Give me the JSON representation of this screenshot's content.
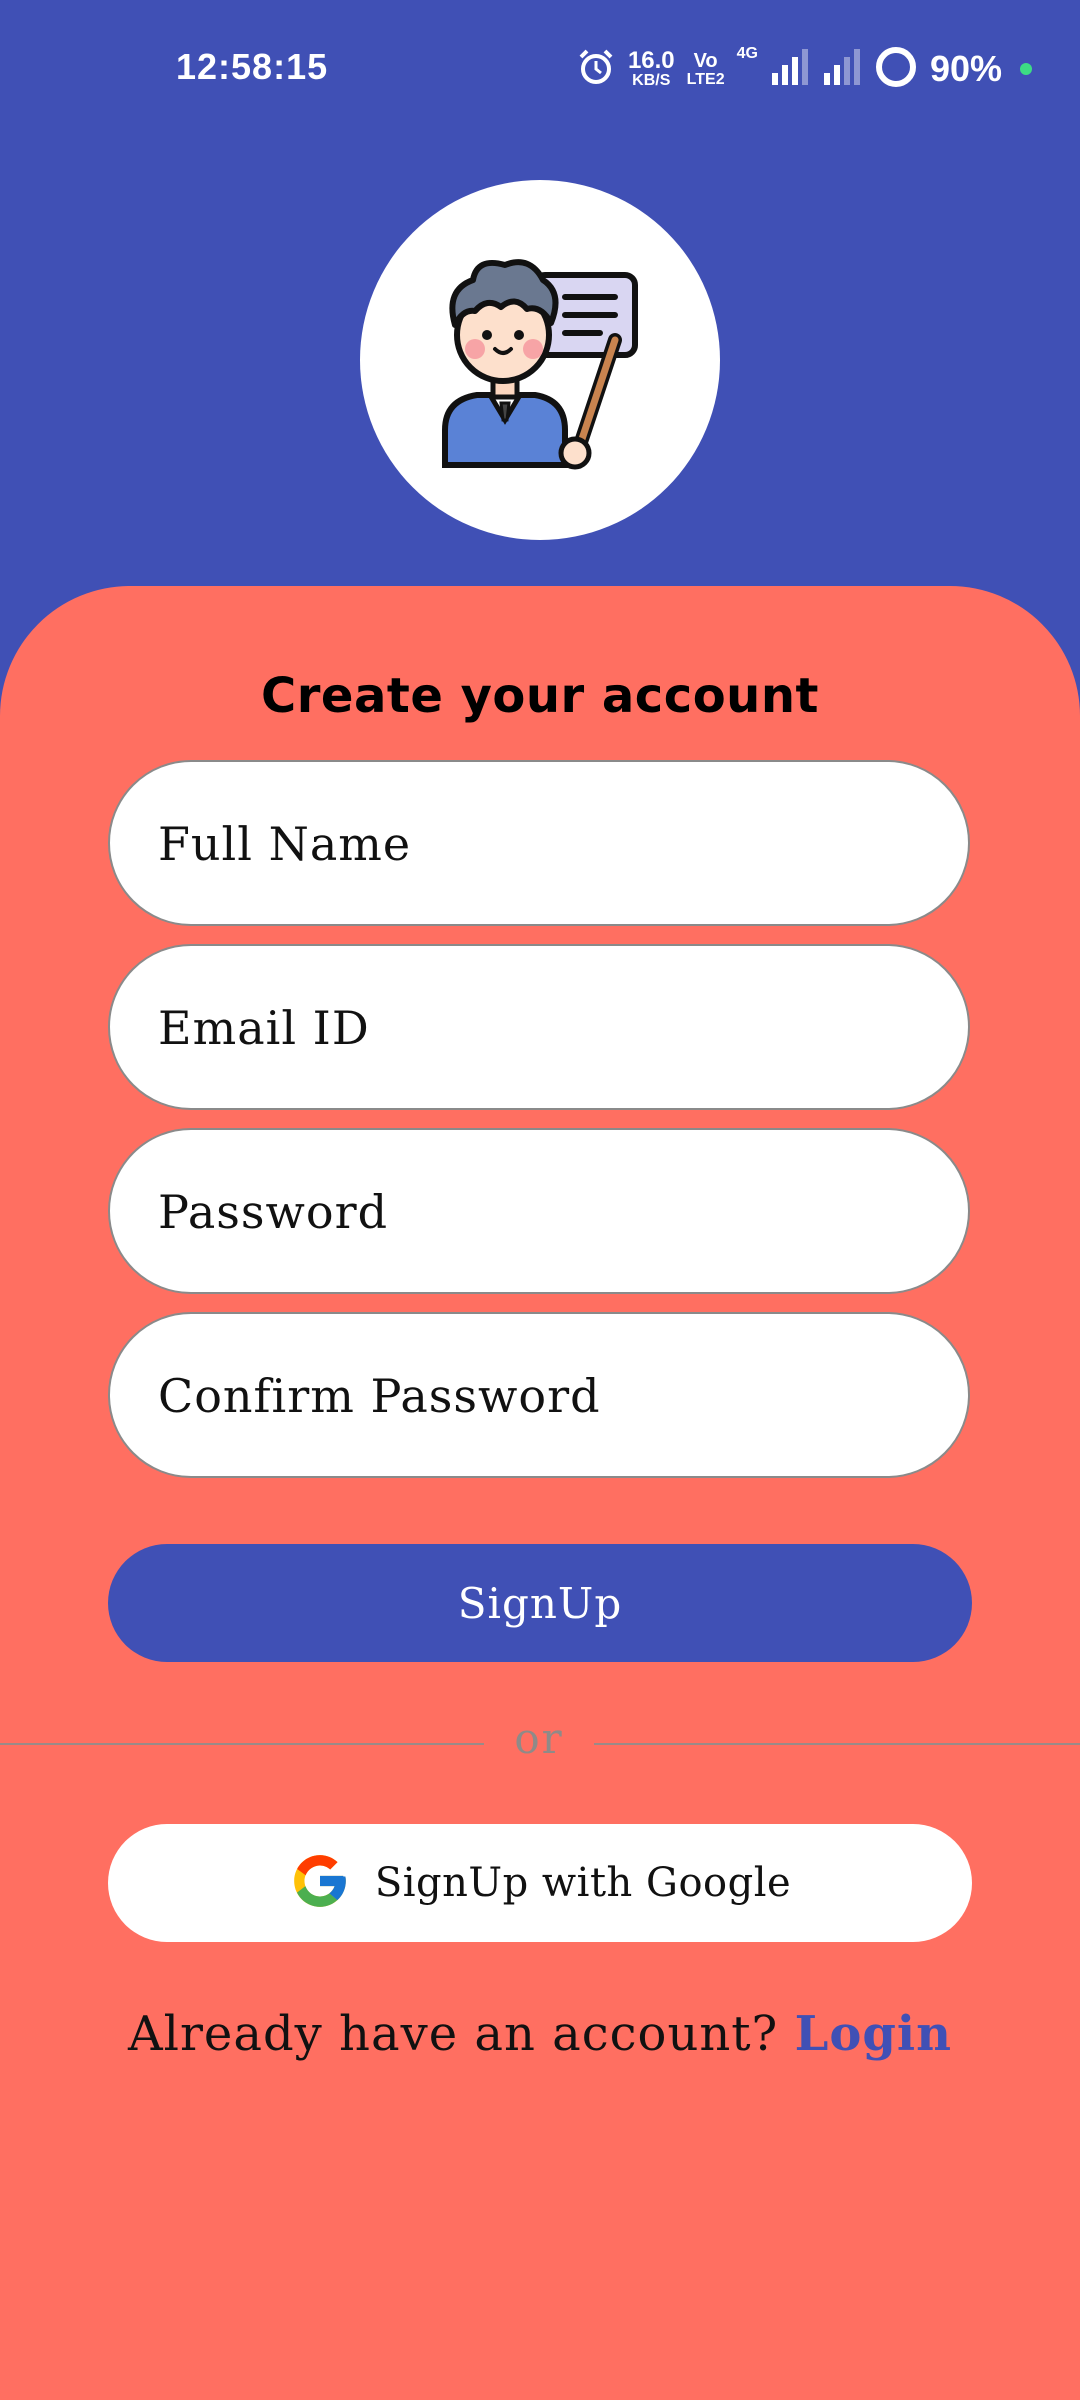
{
  "status_bar": {
    "time": "12:58:15",
    "data_speed_value": "16.0",
    "data_speed_unit": "KB/S",
    "volte_top": "Vo",
    "volte_bottom": "LTE2",
    "network_type": "4G",
    "battery_percent": "90%",
    "icons": [
      "alarm-icon",
      "signal-icon",
      "signal-icon",
      "battery-ring-icon"
    ]
  },
  "title": "Create your account",
  "fields": {
    "full_name_placeholder": "Full Name",
    "email_placeholder": "Email ID",
    "password_placeholder": "Password",
    "confirm_password_placeholder": "Confirm Password"
  },
  "signup_label": "SignUp",
  "divider_text": "or",
  "google_label": "SignUp with Google",
  "login_prompt": "Already have an account?",
  "login_link": "Login",
  "colors": {
    "primary": "#4050b5",
    "card": "#ff6f61",
    "white": "#ffffff"
  }
}
